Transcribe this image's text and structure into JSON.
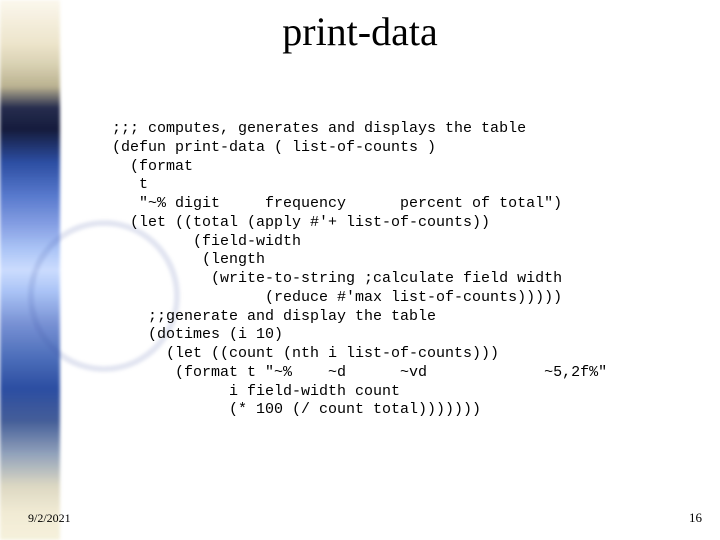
{
  "slide": {
    "title": "print-data",
    "code": ";;; computes, generates and displays the table\n(defun print-data ( list-of-counts )\n  (format\n   t\n   \"~% digit     frequency      percent of total\")\n  (let ((total (apply #'+ list-of-counts))\n         (field-width\n          (length\n           (write-to-string ;calculate field width\n                 (reduce #'max list-of-counts)))))\n    ;;generate and display the table\n    (dotimes (i 10)\n      (let ((count (nth i list-of-counts)))\n       (format t \"~%    ~d      ~vd             ~5,2f%\"\n             i field-width count\n             (* 100 (/ count total)))))))",
    "date": "9/2/2021",
    "page": "16"
  }
}
